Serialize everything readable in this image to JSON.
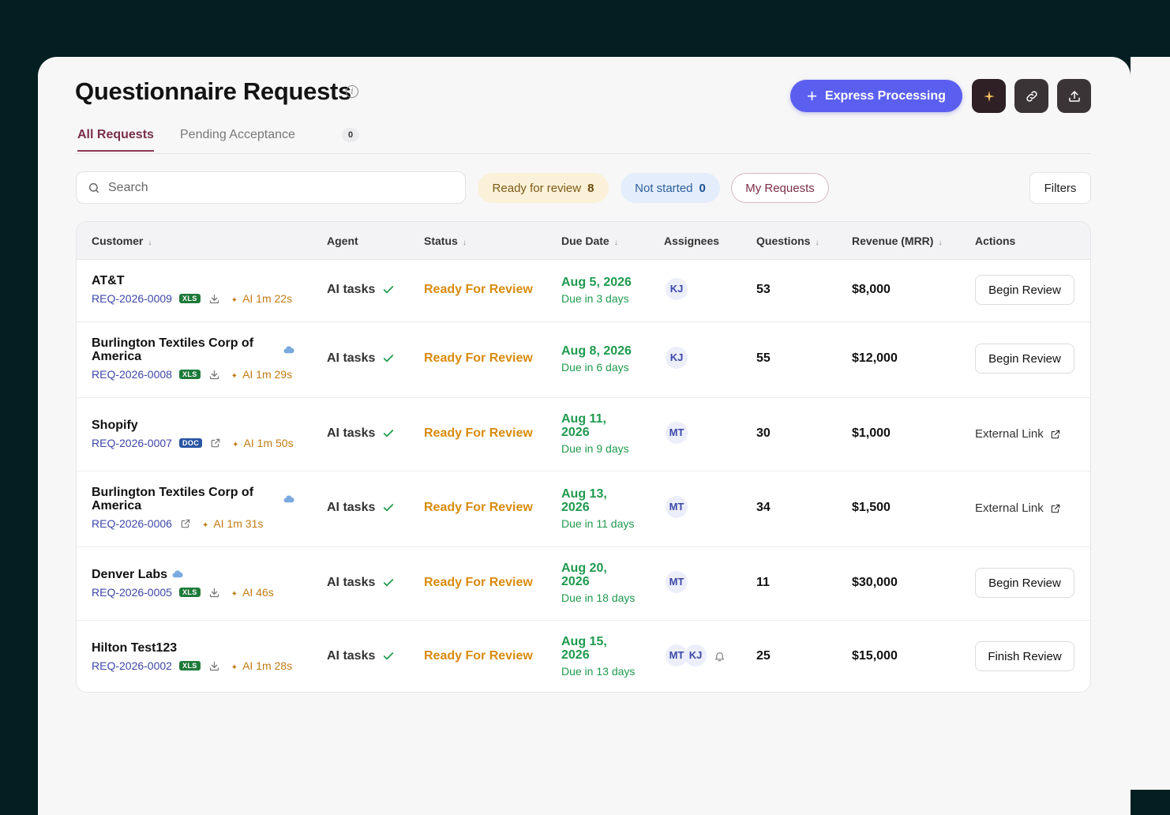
{
  "header": {
    "title": "Questionnaire Requests",
    "info_icon": "info-icon",
    "express_label": "Express Processing",
    "icon_buttons": [
      "sparkle-icon",
      "link-icon",
      "upload-icon"
    ]
  },
  "tabs": [
    {
      "label": "All Requests",
      "active": true
    },
    {
      "label": "Pending Acceptance",
      "count": "0"
    }
  ],
  "toolbar": {
    "search_placeholder": "Search",
    "chip_review_label": "Ready for review",
    "chip_review_count": "8",
    "chip_notstarted_label": "Not started",
    "chip_notstarted_count": "0",
    "chip_mine_label": "My Requests",
    "filters_label": "Filters"
  },
  "columns": {
    "customer": "Customer",
    "agent": "Agent",
    "status": "Status",
    "due_date": "Due Date",
    "assignees": "Assignees",
    "questions": "Questions",
    "revenue": "Revenue (MRR)",
    "actions": "Actions",
    "sort_arrow": "↓"
  },
  "rows": [
    {
      "customer": "AT&T",
      "req_id": "REQ-2026-0009",
      "file_type": "XLS",
      "ai_time": "AI 1m 22s",
      "agent": "AI tasks",
      "status": "Ready For Review",
      "due_date": "Aug 5, 2026",
      "due_in": "Due in 3 days",
      "assignees": [
        "KJ"
      ],
      "questions": "53",
      "revenue": "$8,000",
      "action": "Begin Review"
    },
    {
      "customer": "Burlington Textiles Corp of America",
      "req_id": "REQ-2026-0008",
      "file_type": "XLS",
      "ai_time": "AI 1m 29s",
      "agent": "AI tasks",
      "status": "Ready For Review",
      "due_date": "Aug 8, 2026",
      "due_in": "Due in 6 days",
      "assignees": [
        "KJ"
      ],
      "questions": "55",
      "revenue": "$12,000",
      "action": "Begin Review"
    },
    {
      "customer": "Shopify",
      "req_id": "REQ-2026-0007",
      "file_type": "DOC",
      "ai_time": "AI 1m 50s",
      "agent": "AI tasks",
      "status": "Ready For Review",
      "due_date": "Aug 11, 2026",
      "due_in": "Due in 9 days",
      "assignees": [
        "MT"
      ],
      "questions": "30",
      "revenue": "$1,000",
      "action": "External Link"
    },
    {
      "customer": "Burlington Textiles Corp of America",
      "req_id": "REQ-2026-0006",
      "file_type": "",
      "ai_time": "AI 1m 31s",
      "agent": "AI tasks",
      "status": "Ready For Review",
      "due_date": "Aug 13, 2026",
      "due_in": "Due in 11 days",
      "assignees": [
        "MT"
      ],
      "questions": "34",
      "revenue": "$1,500",
      "action": "External Link"
    },
    {
      "customer": "Denver Labs",
      "req_id": "REQ-2026-0005",
      "file_type": "XLS",
      "ai_time": "AI 46s",
      "agent": "AI tasks",
      "status": "Ready For Review",
      "due_date": "Aug 20, 2026",
      "due_in": "Due in 18 days",
      "assignees": [
        "MT"
      ],
      "questions": "11",
      "revenue": "$30,000",
      "action": "Begin Review"
    },
    {
      "customer": "Hilton Test123",
      "req_id": "REQ-2026-0002",
      "file_type": "XLS",
      "ai_time": "AI 1m 28s",
      "agent": "AI tasks",
      "status": "Ready For Review",
      "due_date": "Aug 15, 2026",
      "due_in": "Due in 13 days",
      "assignees": [
        "MT",
        "KJ"
      ],
      "questions": "25",
      "revenue": "$15,000",
      "action": "Finish Review"
    }
  ],
  "colors": {
    "background": "#031f21",
    "accent": "#5b5ff0",
    "status_orange": "#d98b0e",
    "due_green": "#1f9a4e",
    "link_blue": "#3d47a8"
  }
}
